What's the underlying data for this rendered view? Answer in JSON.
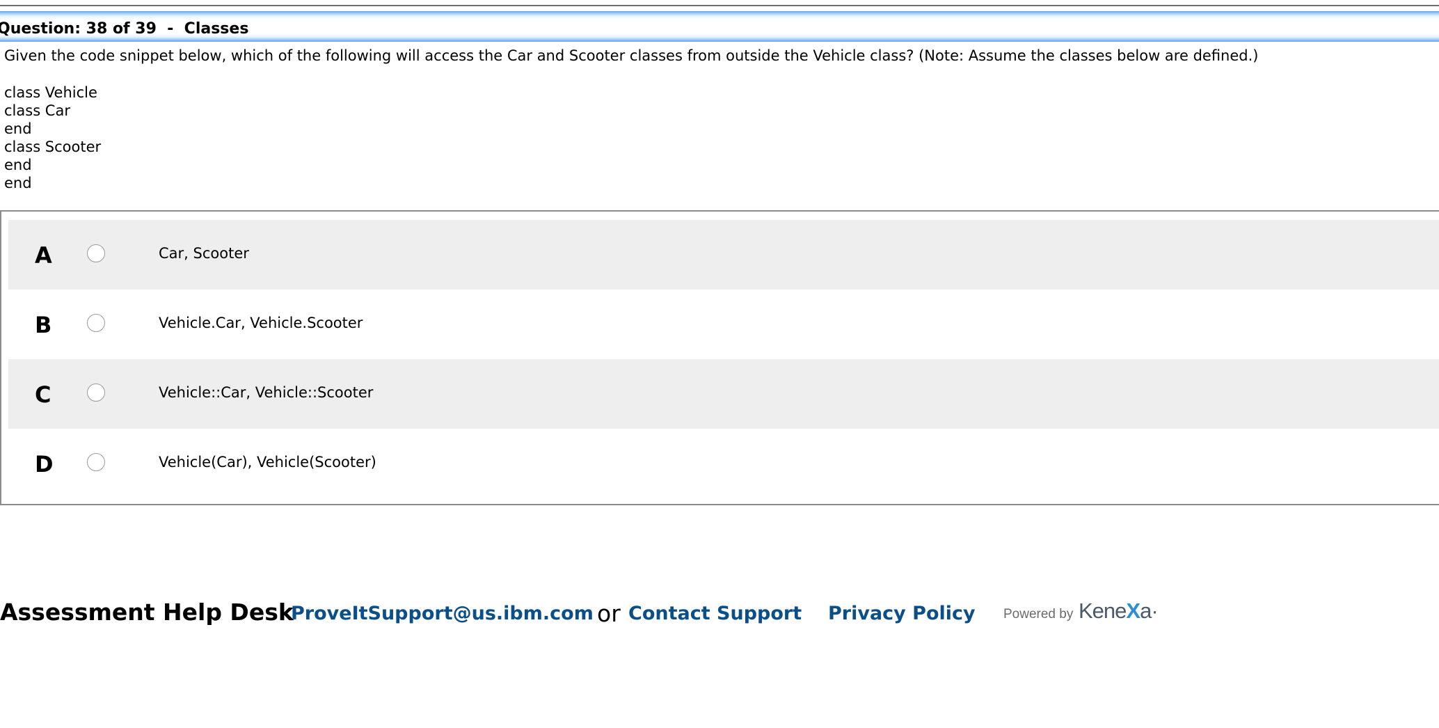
{
  "question": {
    "header": "Question: 38 of 39  -  Classes",
    "prompt": "Given the code snippet below, which of the following will access the Car and Scooter classes from outside the Vehicle class? (Note: Assume the classes below are defined.)",
    "code_lines": [
      "class Vehicle",
      "class Car",
      "end",
      "class Scooter",
      "end",
      "end"
    ]
  },
  "answers": [
    {
      "letter": "A",
      "text": "Car, Scooter"
    },
    {
      "letter": "B",
      "text": "Vehicle.Car, Vehicle.Scooter"
    },
    {
      "letter": "C",
      "text": "Vehicle::Car, Vehicle::Scooter"
    },
    {
      "letter": "D",
      "text": "Vehicle(Car), Vehicle(Scooter)"
    }
  ],
  "footer": {
    "help_desk_label": "Assessment Help Desk",
    "email_link": "ProveItSupport@us.ibm.com",
    "or_text": "or",
    "contact_link": "Contact Support",
    "privacy_link": "Privacy Policy",
    "powered_by": "Powered by",
    "brand_pre": "Kene",
    "brand_x": "X",
    "brand_post": "a",
    "brand_mark": "·"
  },
  "colors": {
    "link": "#0b4f8a",
    "header_band": "#5aa5ee",
    "row_shade": "#eeeeee"
  }
}
